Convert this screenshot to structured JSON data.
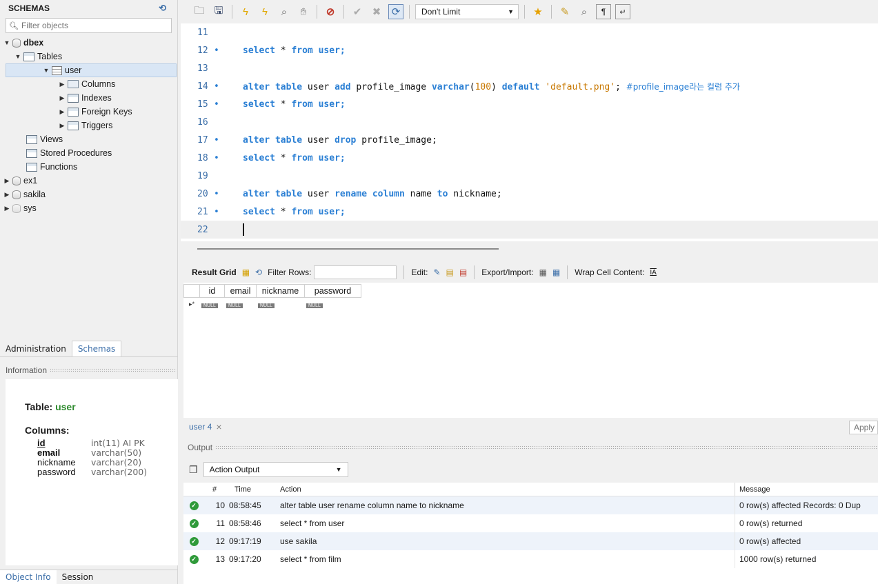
{
  "sidebar": {
    "title": "SCHEMAS",
    "filter_placeholder": "Filter objects",
    "tree": {
      "dbex": "dbex",
      "tables": "Tables",
      "user": "user",
      "columns": "Columns",
      "indexes": "Indexes",
      "foreign_keys": "Foreign Keys",
      "triggers": "Triggers",
      "views": "Views",
      "stored_procedures": "Stored Procedures",
      "functions": "Functions",
      "ex1": "ex1",
      "sakila": "sakila",
      "sys": "sys"
    },
    "tabs": {
      "administration": "Administration",
      "schemas": "Schemas"
    },
    "information_label": "Information",
    "info": {
      "table_label": "Table:",
      "table_name": "user",
      "columns_label": "Columns:",
      "columns": [
        {
          "name": "id",
          "type": "int(11) AI PK"
        },
        {
          "name": "email",
          "type": "varchar(50)"
        },
        {
          "name": "nickname",
          "type": "varchar(20)"
        },
        {
          "name": "password",
          "type": "varchar(200)"
        }
      ]
    },
    "bottom_tabs": {
      "object_info": "Object Info",
      "session": "Session"
    }
  },
  "toolbar": {
    "limit_select": "Don't Limit"
  },
  "editor": {
    "lines": [
      {
        "num": "11",
        "dot": "",
        "tokens": []
      },
      {
        "num": "12",
        "dot": "•",
        "parts": [
          "select",
          " * ",
          "from",
          " user;"
        ]
      },
      {
        "num": "13",
        "dot": "",
        "parts": []
      },
      {
        "num": "14",
        "dot": "•",
        "text": "alter table user add profile_image varchar(100) default 'default.png'; #profile_image라는 컬럼 추가"
      },
      {
        "num": "15",
        "dot": "•",
        "parts": [
          "select",
          " * ",
          "from",
          " user;"
        ]
      },
      {
        "num": "16",
        "dot": "",
        "parts": []
      },
      {
        "num": "17",
        "dot": "•",
        "text": "alter table user drop profile_image;"
      },
      {
        "num": "18",
        "dot": "•",
        "parts": [
          "select",
          " * ",
          "from",
          " user;"
        ]
      },
      {
        "num": "19",
        "dot": "",
        "parts": []
      },
      {
        "num": "20",
        "dot": "•",
        "text": "alter table user rename column name to nickname;"
      },
      {
        "num": "21",
        "dot": "•",
        "parts": [
          "select",
          " * ",
          "from",
          " user;"
        ]
      },
      {
        "num": "22",
        "dot": "",
        "parts": []
      }
    ],
    "l14": {
      "kw1": "alter table",
      "t1": " user ",
      "kw2": "add",
      "t2": " profile_image ",
      "kw3": "varchar",
      "t3": "(",
      "n": "100",
      "t4": ") ",
      "kw4": "default",
      "t5": " ",
      "str": "'default.png'",
      "t6": "; ",
      "cm": "#profile_image라는 컬럼 추가"
    },
    "l17": {
      "kw1": "alter table",
      "t1": " user ",
      "kw2": "drop",
      "t2": " profile_image;"
    },
    "l20": {
      "kw1": "alter table",
      "t1": " user ",
      "kw2": "rename column",
      "t2": " name ",
      "kw3": "to",
      "t3": " nickname;"
    },
    "sel": {
      "kw1": "select",
      "t1": " * ",
      "kw2": "from",
      "t2": " user;"
    }
  },
  "result": {
    "result_grid_label": "Result Grid",
    "filter_rows_label": "Filter Rows:",
    "edit_label": "Edit:",
    "export_label": "Export/Import:",
    "wrap_label": "Wrap Cell Content:",
    "columns": [
      "id",
      "email",
      "nickname",
      "password"
    ],
    "null_text": "NULL",
    "row_marker": "▸*",
    "tab_label": "user 4",
    "tab_close": "×",
    "apply_label": "Apply"
  },
  "output": {
    "header": "Output",
    "select_value": "Action Output",
    "columns": {
      "num": "#",
      "time": "Time",
      "action": "Action",
      "message": "Message"
    },
    "rows": [
      {
        "num": "10",
        "time": "08:58:45",
        "action": "alter table user rename column name to nickname",
        "message": "0 row(s) affected Records: 0  Dup"
      },
      {
        "num": "11",
        "time": "08:58:46",
        "action": "select * from user",
        "message": "0 row(s) returned"
      },
      {
        "num": "12",
        "time": "09:17:19",
        "action": "use sakila",
        "message": "0 row(s) affected"
      },
      {
        "num": "13",
        "time": "09:17:20",
        "action": "select * from film",
        "message": "1000 row(s) returned"
      }
    ]
  }
}
